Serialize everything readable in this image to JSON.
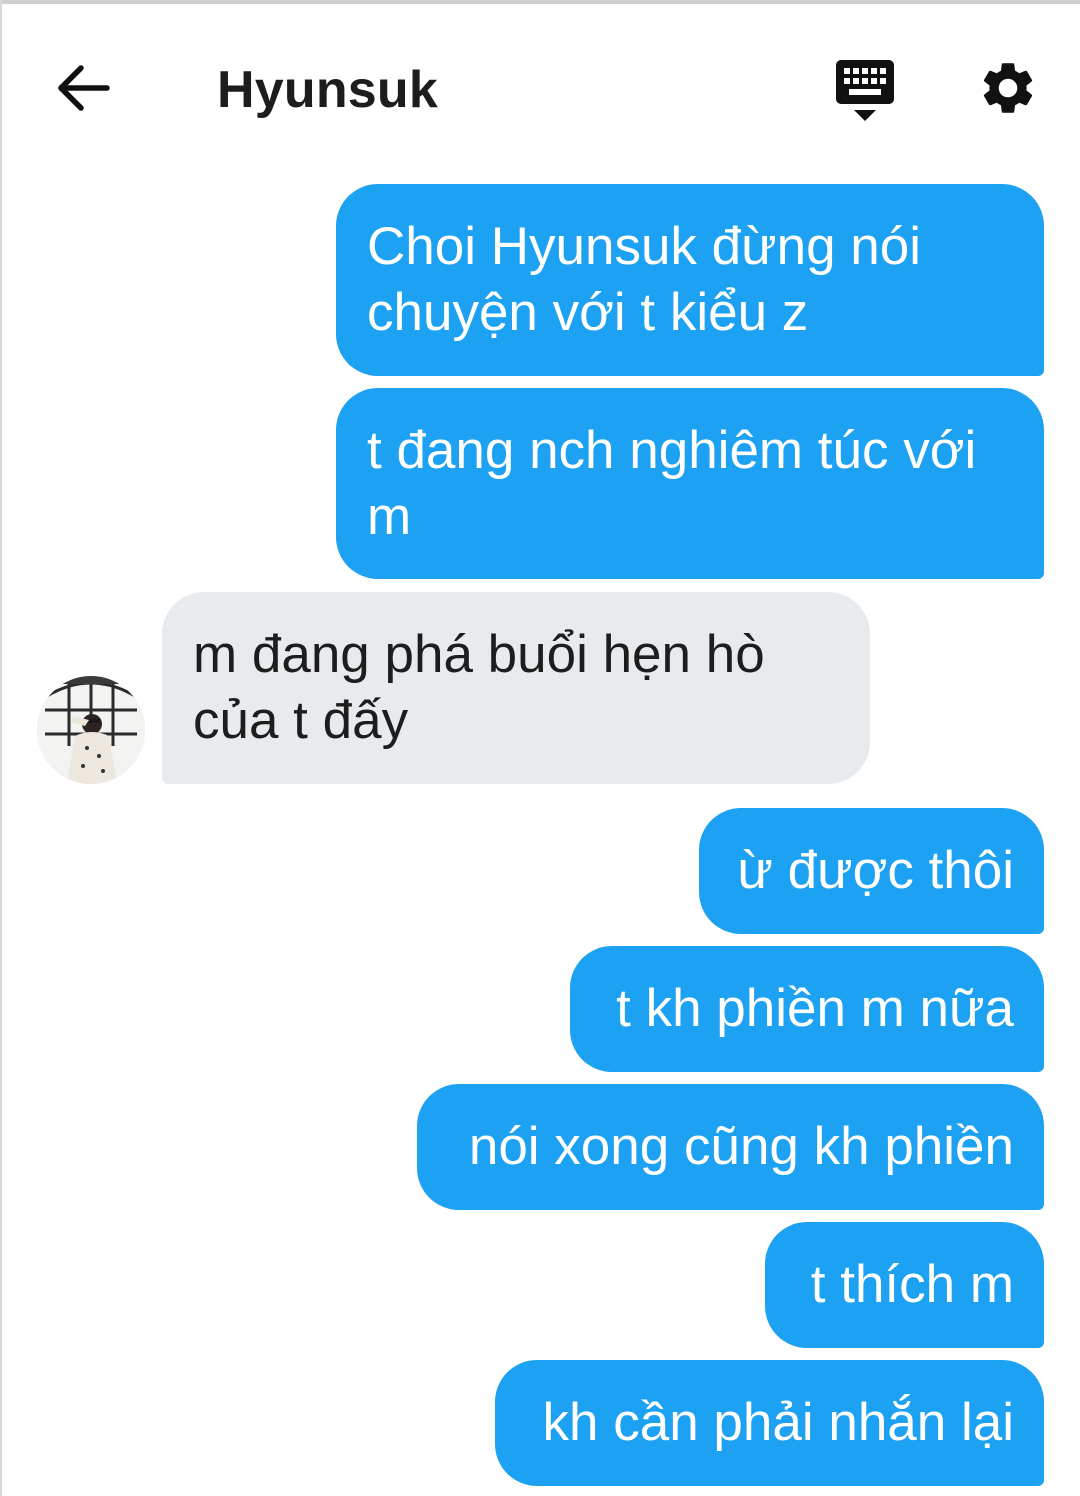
{
  "header": {
    "title": "Hyunsuk",
    "icons": {
      "back": "arrow-left-icon",
      "keyboard": "keyboard-icon",
      "settings": "gear-icon"
    }
  },
  "colors": {
    "outgoing_bubble": "#1da1f2",
    "incoming_bubble": "#e7ebee",
    "outgoing_text": "#ffffff",
    "incoming_text": "#1d1d1d"
  },
  "messages": [
    {
      "direction": "outgoing",
      "text": "Choi Hyunsuk đừng nói chuyện với t kiểu z"
    },
    {
      "direction": "outgoing",
      "text": "t đang nch nghiêm túc với m"
    },
    {
      "direction": "incoming",
      "text": "m đang phá buổi hẹn hò của t đấy"
    },
    {
      "direction": "outgoing",
      "text": "ừ được thôi"
    },
    {
      "direction": "outgoing",
      "text": "t kh phiền m nữa"
    },
    {
      "direction": "outgoing",
      "text": "nói xong cũng kh phiền"
    },
    {
      "direction": "outgoing",
      "text": "t thích m"
    },
    {
      "direction": "outgoing",
      "text": "kh cần phải nhắn lại"
    }
  ]
}
